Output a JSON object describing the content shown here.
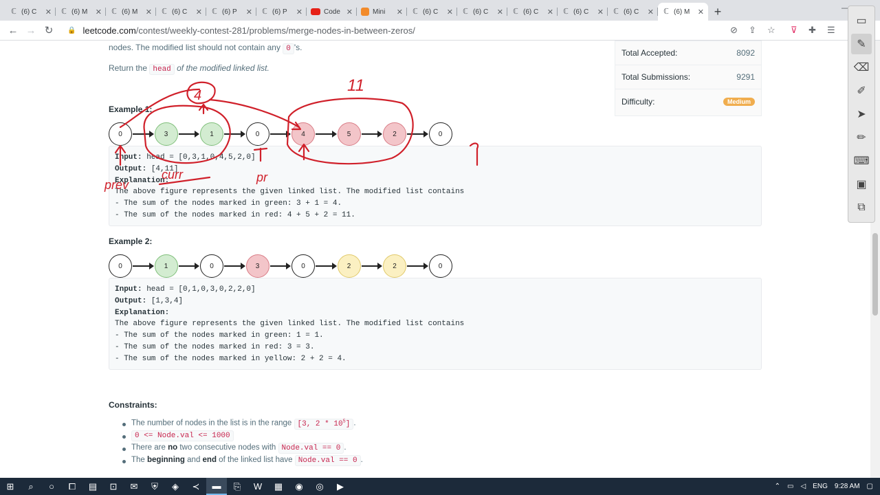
{
  "browser": {
    "tabs": [
      {
        "title": "(6) C",
        "icon": "leetcode-icon"
      },
      {
        "title": "(6) M",
        "icon": "leetcode-icon"
      },
      {
        "title": "(6) M",
        "icon": "leetcode-icon"
      },
      {
        "title": "(6) C",
        "icon": "leetcode-icon"
      },
      {
        "title": "(6) P",
        "icon": "leetcode-icon"
      },
      {
        "title": "(6) P",
        "icon": "leetcode-icon"
      },
      {
        "title": "Code",
        "icon": "youtube-icon"
      },
      {
        "title": "Mini",
        "icon": "mini-icon"
      },
      {
        "title": "(6) C",
        "icon": "leetcode-icon"
      },
      {
        "title": "(6) C",
        "icon": "leetcode-icon"
      },
      {
        "title": "(6) C",
        "icon": "leetcode-icon"
      },
      {
        "title": "(6) C",
        "icon": "leetcode-icon"
      },
      {
        "title": "(6) C",
        "icon": "leetcode-icon"
      },
      {
        "title": "(6) M",
        "icon": "leetcode-icon",
        "active": true
      }
    ],
    "url_host": "leetcode.com",
    "url_path": "/contest/weekly-contest-281/problems/merge-nodes-in-between-zeros/"
  },
  "problem": {
    "intro_pre": "nodes. The modified list should not contain any ",
    "intro_code": "0",
    "intro_post": "'s.",
    "return_pre": "Return the ",
    "return_code": "head",
    "return_post": " of the modified linked list.",
    "example1": {
      "title": "Example 1:",
      "nodes": [
        {
          "v": "0",
          "c": ""
        },
        {
          "v": "3",
          "c": "g"
        },
        {
          "v": "1",
          "c": "g"
        },
        {
          "v": "0",
          "c": ""
        },
        {
          "v": "4",
          "c": "r"
        },
        {
          "v": "5",
          "c": "r"
        },
        {
          "v": "2",
          "c": "r"
        },
        {
          "v": "0",
          "c": ""
        }
      ],
      "input_label": "Input:",
      "input": " head = [0,3,1,0,4,5,2,0]",
      "output_label": "Output:",
      "output": " [4,11]",
      "explanation_label": "Explanation:",
      "lines": [
        "The above figure represents the given linked list. The modified list contains",
        "- The sum of the nodes marked in green: 3 + 1 = 4.",
        "- The sum of the nodes marked in red: 4 + 5 + 2 = 11."
      ]
    },
    "example2": {
      "title": "Example 2:",
      "nodes": [
        {
          "v": "0",
          "c": ""
        },
        {
          "v": "1",
          "c": "g"
        },
        {
          "v": "0",
          "c": ""
        },
        {
          "v": "3",
          "c": "r"
        },
        {
          "v": "0",
          "c": ""
        },
        {
          "v": "2",
          "c": "y"
        },
        {
          "v": "2",
          "c": "y"
        },
        {
          "v": "0",
          "c": ""
        }
      ],
      "input_label": "Input:",
      "input": " head = [0,1,0,3,0,2,2,0]",
      "output_label": "Output:",
      "output": " [1,3,4]",
      "explanation_label": "Explanation:",
      "lines": [
        "The above figure represents the given linked list. The modified list contains",
        "- The sum of the nodes marked in green: 1 = 1.",
        "- The sum of the nodes marked in red: 3 = 3.",
        "- The sum of the nodes marked in yellow: 2 + 2 = 4."
      ]
    },
    "constraints_title": "Constraints:",
    "constraints": {
      "c1_pre": "The number of nodes in the list is in the range ",
      "c1_code": "[3, 2 * 10",
      "c1_sup": "5",
      "c1_code_end": "]",
      "c1_post": ".",
      "c2_code": "0 <= Node.val <= 1000",
      "c3_pre": "There are ",
      "c3_bold": "no",
      "c3_mid": " two consecutive nodes with ",
      "c3_code": "Node.val == 0",
      "c3_post": ".",
      "c4_pre": "The ",
      "c4_b1": "beginning",
      "c4_mid": " and ",
      "c4_b2": "end",
      "c4_mid2": " of the linked list have ",
      "c4_code": "Node.val == 0",
      "c4_post": "."
    }
  },
  "stats": {
    "accepted_label": "Total Accepted:",
    "accepted": "8092",
    "submissions_label": "Total Submissions:",
    "submissions": "9291",
    "difficulty_label": "Difficulty:",
    "difficulty": "Medium",
    "difficulty_color": "#f0ad4e"
  },
  "annotations": {
    "ink_color": "#d0202a",
    "labels": [
      "4",
      "11",
      "prev",
      "curr",
      "pr"
    ]
  },
  "taskbar": {
    "lang": "ENG",
    "time": "9:28 AM"
  }
}
